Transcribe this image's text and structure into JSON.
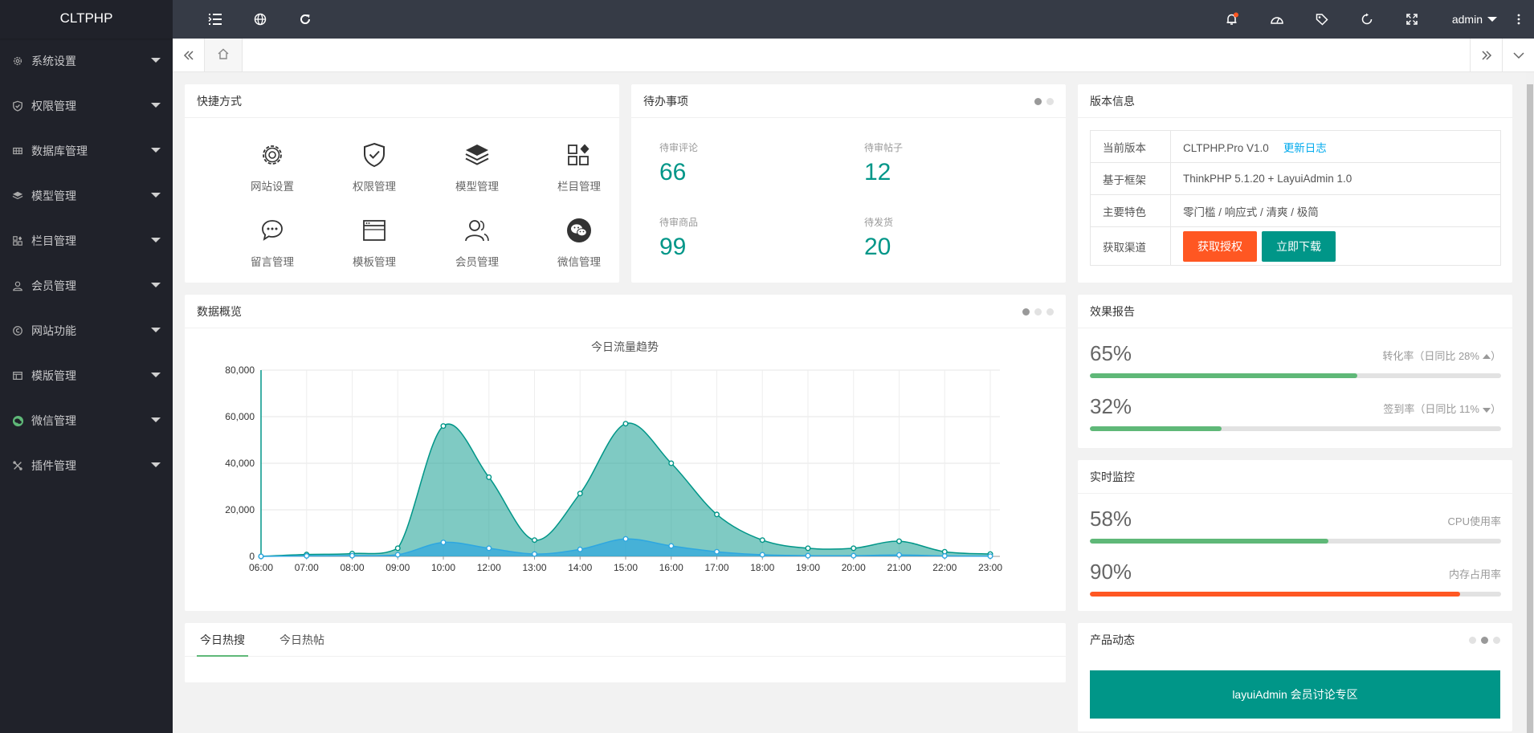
{
  "app": {
    "logo": "CLTPHP"
  },
  "sidebar": {
    "items": [
      {
        "label": "系统设置",
        "icon": "gear-icon"
      },
      {
        "label": "权限管理",
        "icon": "shield-icon"
      },
      {
        "label": "数据库管理",
        "icon": "database-icon"
      },
      {
        "label": "模型管理",
        "icon": "layers-icon"
      },
      {
        "label": "栏目管理",
        "icon": "app-grid-icon"
      },
      {
        "label": "会员管理",
        "icon": "user-icon"
      },
      {
        "label": "网站功能",
        "icon": "function-icon"
      },
      {
        "label": "模版管理",
        "icon": "template-icon"
      },
      {
        "label": "微信管理",
        "icon": "wechat-icon"
      },
      {
        "label": "插件管理",
        "icon": "plugin-icon"
      }
    ]
  },
  "topbar": {
    "user": "admin"
  },
  "colors": {
    "accent": "#009688",
    "sidebar": "#20222a",
    "topbar": "#363b46",
    "warm": "#ff5722",
    "progress_green": "#5fb878",
    "link": "#01aaed"
  },
  "shortcuts": {
    "title": "快捷方式",
    "items": [
      "网站设置",
      "权限管理",
      "模型管理",
      "栏目管理",
      "留言管理",
      "模板管理",
      "会员管理",
      "微信管理"
    ]
  },
  "todo": {
    "title": "待办事项",
    "items": [
      {
        "label": "待审评论",
        "value": "66"
      },
      {
        "label": "待审帖子",
        "value": "12"
      },
      {
        "label": "待审商品",
        "value": "99"
      },
      {
        "label": "待发货",
        "value": "20"
      }
    ]
  },
  "version": {
    "title": "版本信息",
    "rows": [
      {
        "key": "当前版本",
        "value": "CLTPHP.Pro V1.0",
        "link": "更新日志"
      },
      {
        "key": "基于框架",
        "value": "ThinkPHP 5.1.20 + LayuiAdmin 1.0"
      },
      {
        "key": "主要特色",
        "value": "零门槛 / 响应式 / 清爽 / 极简"
      },
      {
        "key": "获取渠道",
        "buttons": [
          "获取授权",
          "立即下载"
        ]
      }
    ]
  },
  "overview": {
    "title": "数据概览"
  },
  "chart_data": {
    "type": "area",
    "title": "今日流量趋势",
    "categories": [
      "06:00",
      "07:00",
      "08:00",
      "09:00",
      "10:00",
      "12:00",
      "13:00",
      "14:00",
      "15:00",
      "16:00",
      "17:00",
      "18:00",
      "19:00",
      "20:00",
      "21:00",
      "22:00",
      "23:00"
    ],
    "series": [
      {
        "values": [
          0,
          800,
          1200,
          3500,
          56000,
          34000,
          7000,
          27000,
          57000,
          40000,
          18000,
          7000,
          3500,
          3500,
          6500,
          2000,
          1000
        ]
      },
      {
        "values": [
          0,
          200,
          300,
          700,
          6000,
          3500,
          1000,
          3000,
          7500,
          4500,
          2000,
          700,
          300,
          300,
          600,
          200,
          100
        ]
      }
    ],
    "ylim": [
      0,
      80000
    ],
    "yticks": [
      "0",
      "20,000",
      "40,000",
      "60,000",
      "80,000"
    ],
    "grid": true,
    "colors": [
      "#009688",
      "#2ea7e0"
    ]
  },
  "effect": {
    "title": "效果报告",
    "rows": [
      {
        "big": "65%",
        "note": "转化率（日同比 28%",
        "percent": 65,
        "trend": "up"
      },
      {
        "big": "32%",
        "note": "签到率（日同比 11%",
        "percent": 32,
        "trend": "down"
      }
    ]
  },
  "monitor": {
    "title": "实时监控",
    "rows": [
      {
        "big": "58%",
        "note": "CPU使用率",
        "percent": 58
      },
      {
        "big": "90%",
        "note": "内存占用率",
        "percent": 90
      }
    ]
  },
  "hot": {
    "tabs": [
      "今日热搜",
      "今日热帖"
    ]
  },
  "product": {
    "title": "产品动态",
    "banner": "layuiAdmin 会员讨论专区"
  }
}
